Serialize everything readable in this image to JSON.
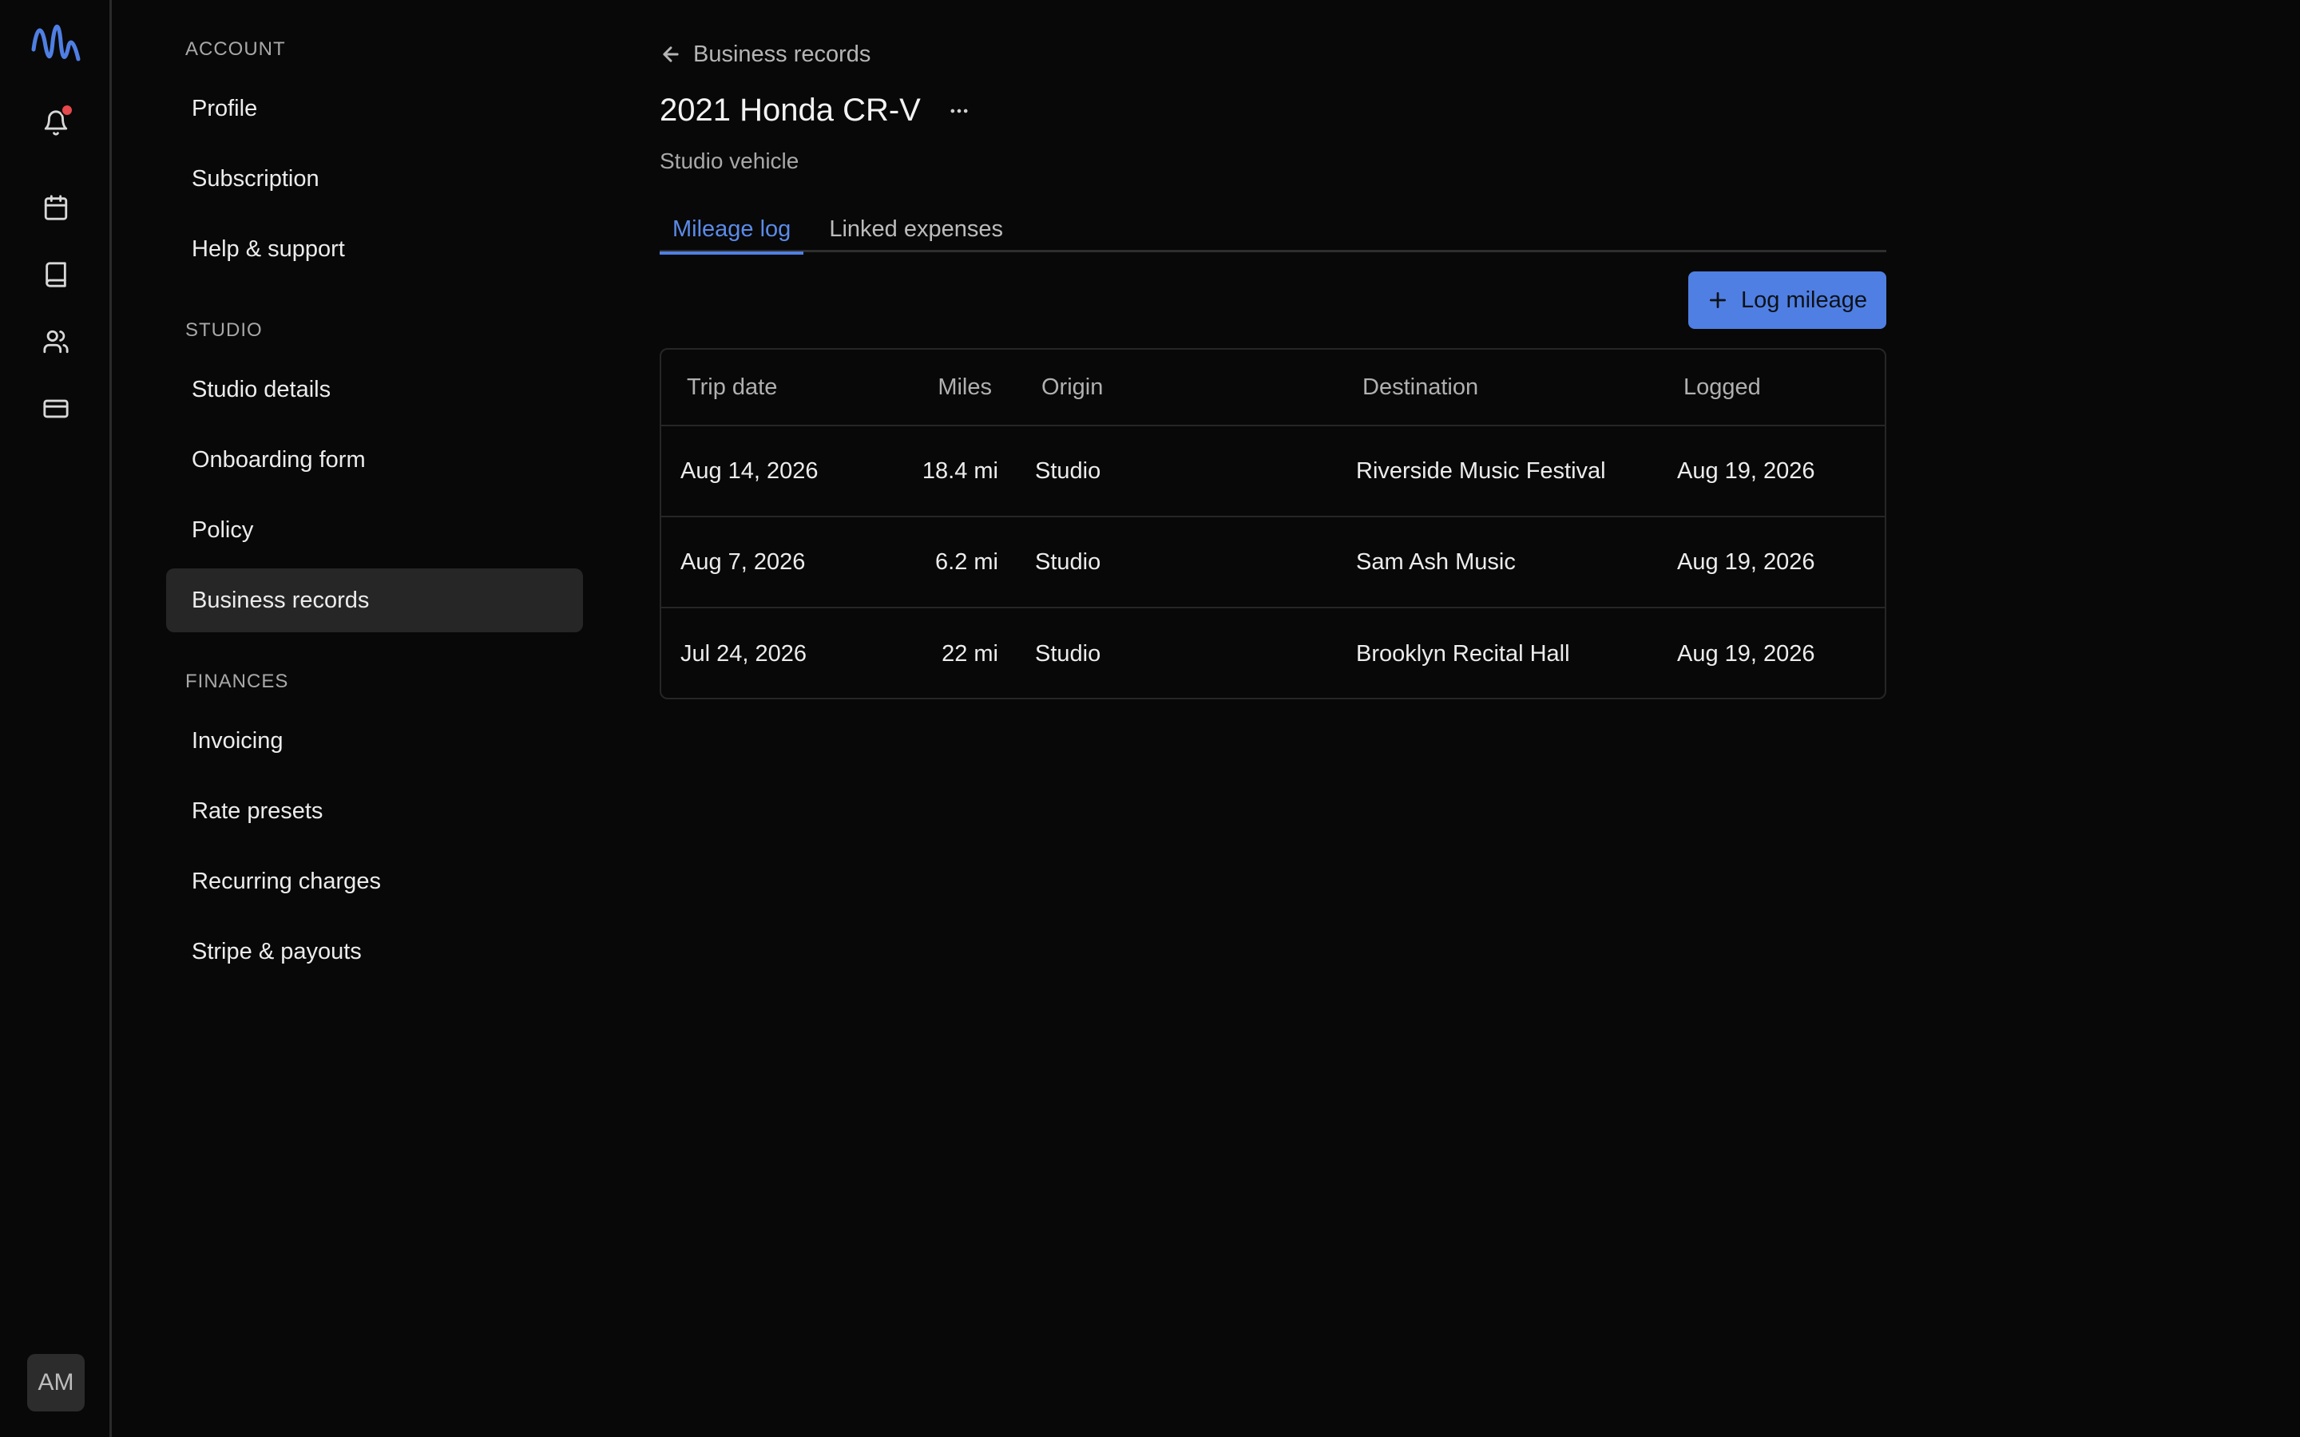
{
  "rail": {
    "avatar_initials": "AM",
    "icons": [
      "app-logo-icon",
      "bell-icon",
      "calendar-icon",
      "book-icon",
      "users-icon",
      "credit-card-icon"
    ],
    "accent": "#4f7fe3",
    "notification_color": "#e5484d"
  },
  "nav": {
    "sections": [
      {
        "title": "ACCOUNT",
        "items": [
          "Profile",
          "Subscription",
          "Help & support"
        ]
      },
      {
        "title": "STUDIO",
        "items": [
          "Studio details",
          "Onboarding form",
          "Policy",
          "Business records"
        ]
      },
      {
        "title": "FINANCES",
        "items": [
          "Invoicing",
          "Rate presets",
          "Recurring charges",
          "Stripe & payouts"
        ]
      }
    ],
    "active": "Business records"
  },
  "main": {
    "back_label": "Business records",
    "title": "2021 Honda CR-V",
    "subtitle": "Studio vehicle",
    "tabs": [
      {
        "label": "Mileage log",
        "active": true
      },
      {
        "label": "Linked expenses",
        "active": false
      }
    ],
    "log_button_label": "Log mileage",
    "table": {
      "columns": [
        "Trip date",
        "Miles",
        "Origin",
        "Destination",
        "Logged"
      ],
      "rows": [
        [
          "Aug 14, 2026",
          "18.4 mi",
          "Studio",
          "Riverside Music Festival",
          "Aug 19, 2026"
        ],
        [
          "Aug 7, 2026",
          "6.2 mi",
          "Studio",
          "Sam Ash Music",
          "Aug 19, 2026"
        ],
        [
          "Jul 24, 2026",
          "22 mi",
          "Studio",
          "Brooklyn Recital Hall",
          "Aug 19, 2026"
        ]
      ]
    }
  }
}
